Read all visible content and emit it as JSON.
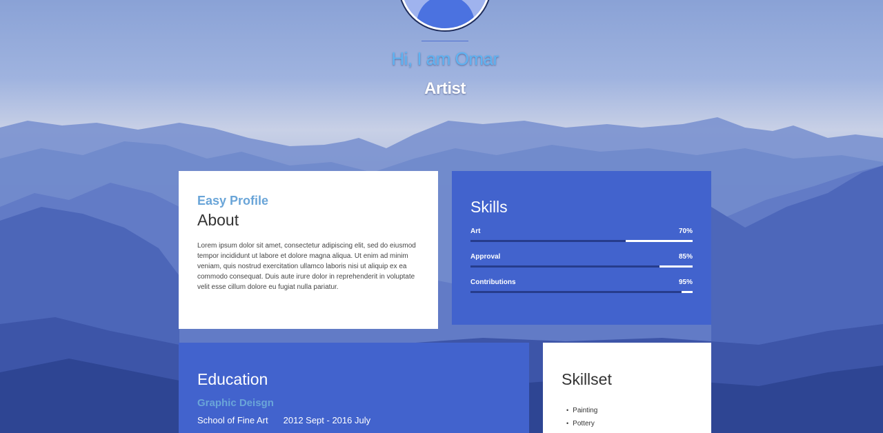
{
  "profile": {
    "greeting": "Hi, I am Omar",
    "role": "Artist"
  },
  "about": {
    "eyebrow": "Easy Profile",
    "title": "About",
    "text": "Lorem ipsum dolor sit amet, consectetur adipiscing elit, sed do eiusmod tempor incididunt ut labore et dolore magna aliqua. Ut enim ad minim veniam, quis nostrud exercitation ullamco laboris nisi ut aliquip ex ea commodo consequat. Duis aute irure dolor in reprehenderit in voluptate velit esse cillum dolore eu fugiat nulla pariatur."
  },
  "skills": {
    "title": "Skills",
    "items": [
      {
        "label": "Art",
        "percent_label": "70%",
        "value": 0.7
      },
      {
        "label": "Approval",
        "percent_label": "85%",
        "value": 0.85
      },
      {
        "label": "Contributions",
        "percent_label": "95%",
        "value": 0.95
      }
    ]
  },
  "education": {
    "title": "Education",
    "degree": "Graphic Deisgn",
    "school": "School of Fine Art",
    "period": "2012 Sept - 2016 July"
  },
  "skillset": {
    "title": "Skillset",
    "items": [
      "Painting",
      "Pottery"
    ]
  },
  "colors": {
    "accent_blue": "#4263cd",
    "heading_light_blue": "#6aa5d8",
    "greeting_blue": "#5fb4f3",
    "progress_dark": "#263c8c"
  }
}
